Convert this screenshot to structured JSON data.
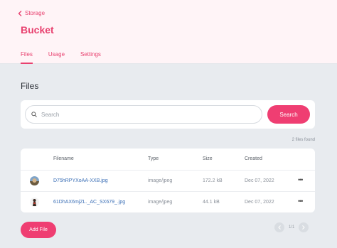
{
  "header": {
    "back_label": "Storage",
    "title": "Bucket",
    "tabs": [
      {
        "label": "Files",
        "active": true
      },
      {
        "label": "Usage",
        "active": false
      },
      {
        "label": "Settings",
        "active": false
      }
    ]
  },
  "main": {
    "section_title": "Files",
    "search": {
      "placeholder": "Search",
      "value": "",
      "button_label": "Search"
    },
    "files_count": "2 files found",
    "table": {
      "columns": [
        "Filename",
        "Type",
        "Size",
        "Created"
      ],
      "rows": [
        {
          "filename": "D75hRPYXoAA-XXB.jpg",
          "type": "image/jpeg",
          "size": "172.2 kB",
          "created": "Dec 07, 2022",
          "thumb": "landscape-thumbnail"
        },
        {
          "filename": "61DhAX6mjZL._AC_SX679_.jpg",
          "type": "image/jpeg",
          "size": "44.1 kB",
          "created": "Dec 07, 2022",
          "thumb": "figure-thumbnail"
        }
      ]
    },
    "add_button_label": "Add File",
    "pagination": {
      "label": "1/1"
    }
  },
  "colors": {
    "accent": "#ef3e72",
    "accent_text": "#e8416f",
    "header_bg": "#fff4f7",
    "page_bg": "#e8ebef",
    "link": "#3b6fb6"
  }
}
